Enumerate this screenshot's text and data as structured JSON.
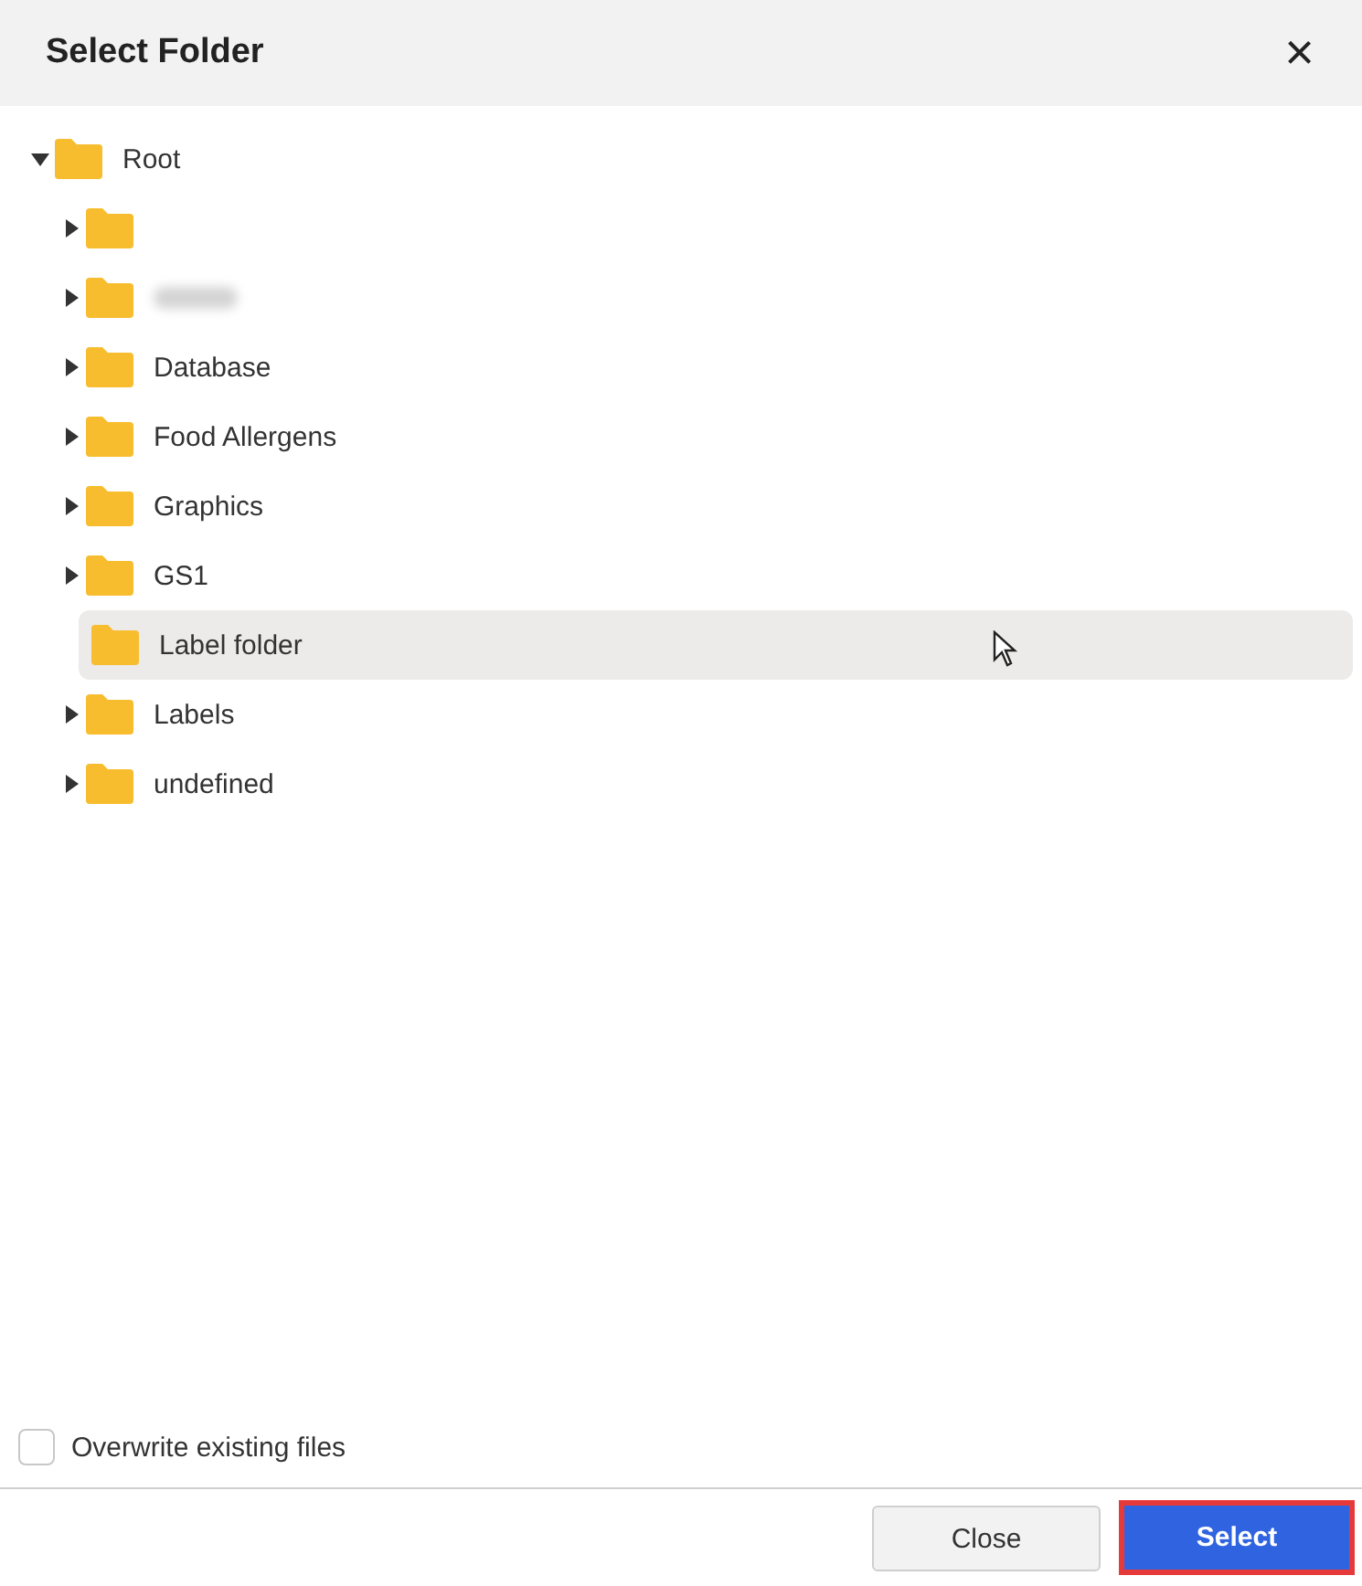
{
  "dialog": {
    "title": "Select Folder",
    "close_glyph": "×"
  },
  "tree": {
    "label": "Root",
    "expanded": true,
    "children": [
      {
        "expandable": true,
        "selected": false
      },
      {
        "kind": "redacted",
        "expandable": true,
        "selected": false
      },
      {
        "label": "Database",
        "expandable": true,
        "selected": false
      },
      {
        "label": "Food Allergens",
        "expandable": true,
        "selected": false
      },
      {
        "label": "Graphics",
        "expandable": true,
        "selected": false
      },
      {
        "label": "GS1",
        "expandable": true,
        "selected": false
      },
      {
        "label": "Label folder",
        "expandable": false,
        "selected": true
      },
      {
        "label": "Labels",
        "expandable": true,
        "selected": false
      },
      {
        "label": "undefined",
        "expandable": true,
        "selected": false
      }
    ]
  },
  "overwrite": {
    "label": "Overwrite existing files",
    "checked": false
  },
  "buttons": [
    {
      "label": "Close",
      "kind": "secondary",
      "focused": false
    },
    {
      "label": "Select",
      "kind": "primary",
      "focused": true
    }
  ]
}
